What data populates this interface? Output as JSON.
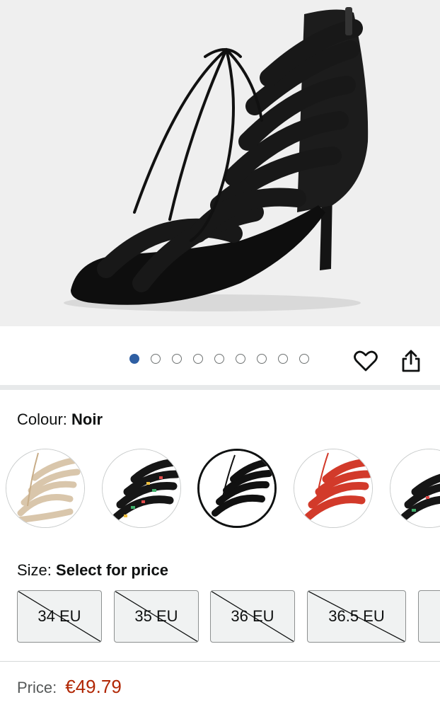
{
  "gallery": {
    "image_alt": "Black lace-up open-toe dance heel",
    "image_count": 9,
    "active_index": 0
  },
  "actions": {
    "favorite_icon": "heart-icon",
    "share_icon": "share-icon"
  },
  "colour": {
    "label": "Colour:",
    "selected": "Noir",
    "options": [
      {
        "name": "Beige",
        "color": "#e9dccb"
      },
      {
        "name": "Multicolour",
        "color": "#1b1b1b"
      },
      {
        "name": "Noir",
        "color": "#111111"
      },
      {
        "name": "Rouge",
        "color": "#d23a2a"
      },
      {
        "name": "Multicolour 2",
        "color": "#1b1b1b"
      }
    ]
  },
  "size": {
    "label": "Size:",
    "selected": "Select for price",
    "options": [
      "34 EU",
      "35 EU",
      "36 EU",
      "36.5 EU"
    ]
  },
  "price": {
    "label": "Price:",
    "value": "€49.79",
    "color": "#b12704"
  }
}
